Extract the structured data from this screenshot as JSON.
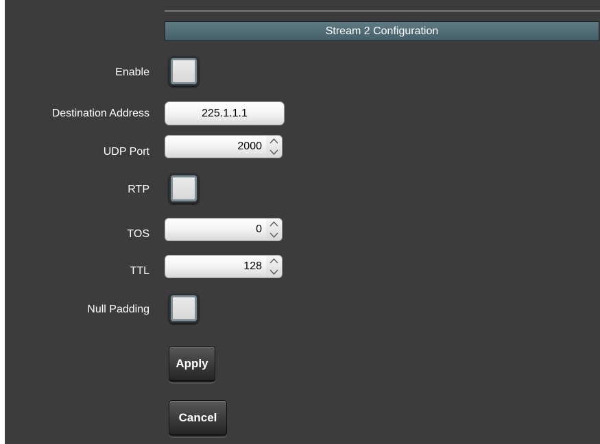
{
  "header": {
    "title": "Stream 2 Configuration"
  },
  "form": {
    "enable": {
      "label": "Enable",
      "checked": false
    },
    "destination_address": {
      "label": "Destination Address",
      "value": "225.1.1.1"
    },
    "udp_port": {
      "label": "UDP Port",
      "value": "2000"
    },
    "rtp": {
      "label": "RTP",
      "checked": false
    },
    "tos": {
      "label": "TOS",
      "value": "0"
    },
    "ttl": {
      "label": "TTL",
      "value": "128"
    },
    "null_padding": {
      "label": "Null Padding",
      "checked": false
    }
  },
  "actions": {
    "apply_label": "Apply",
    "cancel_label": "Cancel"
  },
  "icons": {
    "spin_up": "chevron-up-icon",
    "spin_down": "chevron-down-icon"
  },
  "colors": {
    "background": "#3c3c3c",
    "header_bar": "#4f6b75",
    "text": "#ffffff"
  }
}
